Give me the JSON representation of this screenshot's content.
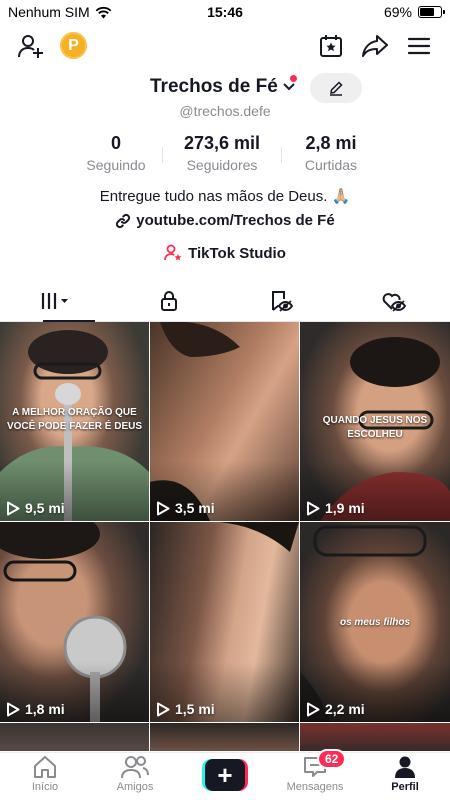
{
  "status_bar": {
    "carrier": "Nenhum SIM",
    "time": "15:46",
    "battery": "69%",
    "battery_level": 0.69
  },
  "profile": {
    "name": "Trechos de Fé",
    "handle": "@trechos.defe",
    "stats": [
      {
        "value": "0",
        "label": "Seguindo"
      },
      {
        "value": "273,6 mil",
        "label": "Seguidores"
      },
      {
        "value": "2,8 mi",
        "label": "Curtidas"
      }
    ],
    "bio": "Entregue tudo nas mãos de Deus. 🙏🏼",
    "link": "youtube.com/Trechos de Fé",
    "studio": "TikTok Studio"
  },
  "tabs": [
    {
      "icon": "grid-icon",
      "active": true
    },
    {
      "icon": "lock-icon",
      "active": false
    },
    {
      "icon": "bookmark-eye-icon",
      "active": false
    },
    {
      "icon": "heart-eye-icon",
      "active": false
    }
  ],
  "videos": [
    {
      "views": "9,5 mi",
      "caption": "A MELHOR ORAÇÃO QUE VOCÊ PODE FAZER É DEUS"
    },
    {
      "views": "3,5 mi",
      "caption": ""
    },
    {
      "views": "1,9 mi",
      "caption": "QUANDO JESUS NOS ESCOLHEU"
    },
    {
      "views": "1,8 mi",
      "caption": ""
    },
    {
      "views": "1,5 mi",
      "caption": ""
    },
    {
      "views": "2,2 mi",
      "caption": "os meus filhos"
    }
  ],
  "nav": {
    "items": [
      {
        "label": "Início",
        "icon": "home-icon"
      },
      {
        "label": "Amigos",
        "icon": "friends-icon"
      },
      {
        "label": "",
        "icon": "create-icon"
      },
      {
        "label": "Mensagens",
        "icon": "inbox-icon",
        "badge": "62"
      },
      {
        "label": "Perfil",
        "icon": "profile-icon"
      }
    ]
  },
  "colors": {
    "accent": "#fe2c55",
    "cyan": "#25f4ee",
    "coin": "#f6b023",
    "text": "#161823",
    "muted": "#8a8b91"
  }
}
